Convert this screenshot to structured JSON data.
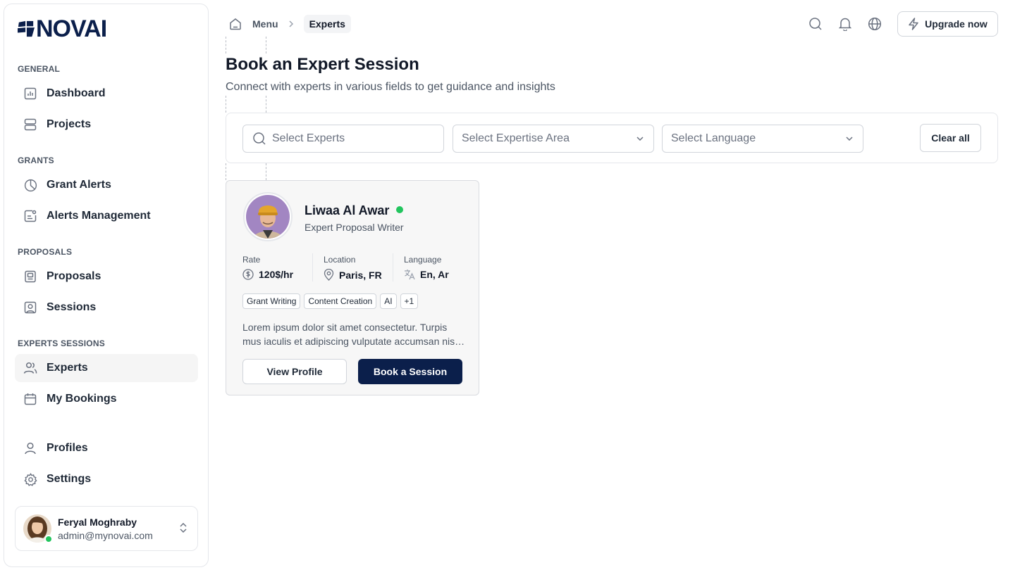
{
  "app": {
    "logo_text": "NOVAI"
  },
  "sidebar": {
    "sections": [
      {
        "label": "GENERAL",
        "items": [
          {
            "label": "Dashboard",
            "icon": "chart-icon"
          },
          {
            "label": "Projects",
            "icon": "server-icon"
          }
        ]
      },
      {
        "label": "GRANTS",
        "items": [
          {
            "label": "Grant Alerts",
            "icon": "pie-chart-icon"
          },
          {
            "label": "Alerts Management",
            "icon": "alert-card-icon"
          }
        ]
      },
      {
        "label": "PROPOSALS",
        "items": [
          {
            "label": "Proposals",
            "icon": "document-icon"
          },
          {
            "label": "Sessions",
            "icon": "user-square-icon"
          }
        ]
      },
      {
        "label": "EXPERTS SESSIONS",
        "items": [
          {
            "label": "Experts",
            "icon": "users-icon",
            "active": true
          },
          {
            "label": "My Bookings",
            "icon": "calendar-icon"
          }
        ]
      }
    ],
    "bottom_items": [
      {
        "label": "Profiles",
        "icon": "user-icon"
      },
      {
        "label": "Settings",
        "icon": "gear-icon"
      }
    ],
    "user": {
      "name": "Feryal Moghraby",
      "email": "admin@mynovai.com",
      "status": "online"
    }
  },
  "topbar": {
    "breadcrumb": [
      "Menu",
      "Experts"
    ],
    "upgrade_label": "Upgrade now",
    "icons": [
      "search-icon",
      "bell-icon",
      "globe-icon"
    ]
  },
  "page": {
    "title": "Book an Expert Session",
    "subtitle": "Connect with experts in various fields to get guidance and insights"
  },
  "filters": {
    "experts_placeholder": "Select Experts",
    "expertise_placeholder": "Select Expertise Area",
    "language_placeholder": "Select Language",
    "clear_label": "Clear all"
  },
  "experts": [
    {
      "name": "Liwaa Al Awar",
      "title": "Expert Proposal Writer",
      "online": true,
      "rate_label": "Rate",
      "rate": "120$/hr",
      "location_label": "Location",
      "location": "Paris, FR",
      "language_label": "Language",
      "languages": "En, Ar",
      "tags": [
        "Grant Writing",
        "Content Creation",
        "AI",
        "+1"
      ],
      "description": "Lorem ipsum dolor sit amet consectetur. Turpis mus iaculis et adipiscing vulputate accumsan nisl sed.",
      "view_label": "View Profile",
      "book_label": "Book a Session"
    }
  ],
  "colors": {
    "brand": "#0b1f4b",
    "online": "#22c55e",
    "active_bg": "#f5f5f5"
  }
}
